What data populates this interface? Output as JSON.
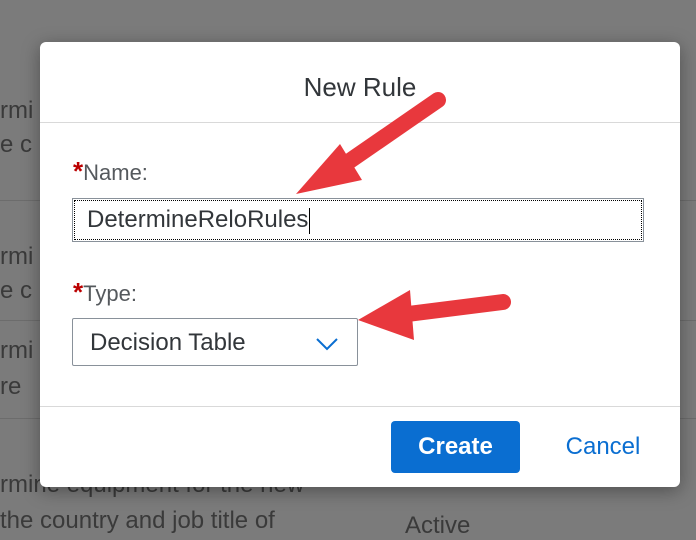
{
  "background": {
    "rows": [
      {
        "line1": "rmi",
        "line2": "e c"
      },
      {
        "line1": "rmi",
        "line2": "e c"
      },
      {
        "line1": "rmi",
        "line2": "re"
      },
      {
        "line1": "rmine equipment for the new",
        "line2": "the country and job title of",
        "status": "Active"
      }
    ]
  },
  "dialog": {
    "title": "New Rule",
    "name_field": {
      "required_mark": "*",
      "label": "Name:",
      "value": "DetermineReloRules"
    },
    "type_field": {
      "required_mark": "*",
      "label": "Type:",
      "value": "Decision Table"
    },
    "footer": {
      "create_label": "Create",
      "cancel_label": "Cancel"
    }
  },
  "colors": {
    "accent": "#0a6ed1",
    "required": "#bb0000",
    "annotation_arrow": "#e8383d"
  },
  "icons": {
    "type_dropdown": "chevron-down-icon"
  }
}
